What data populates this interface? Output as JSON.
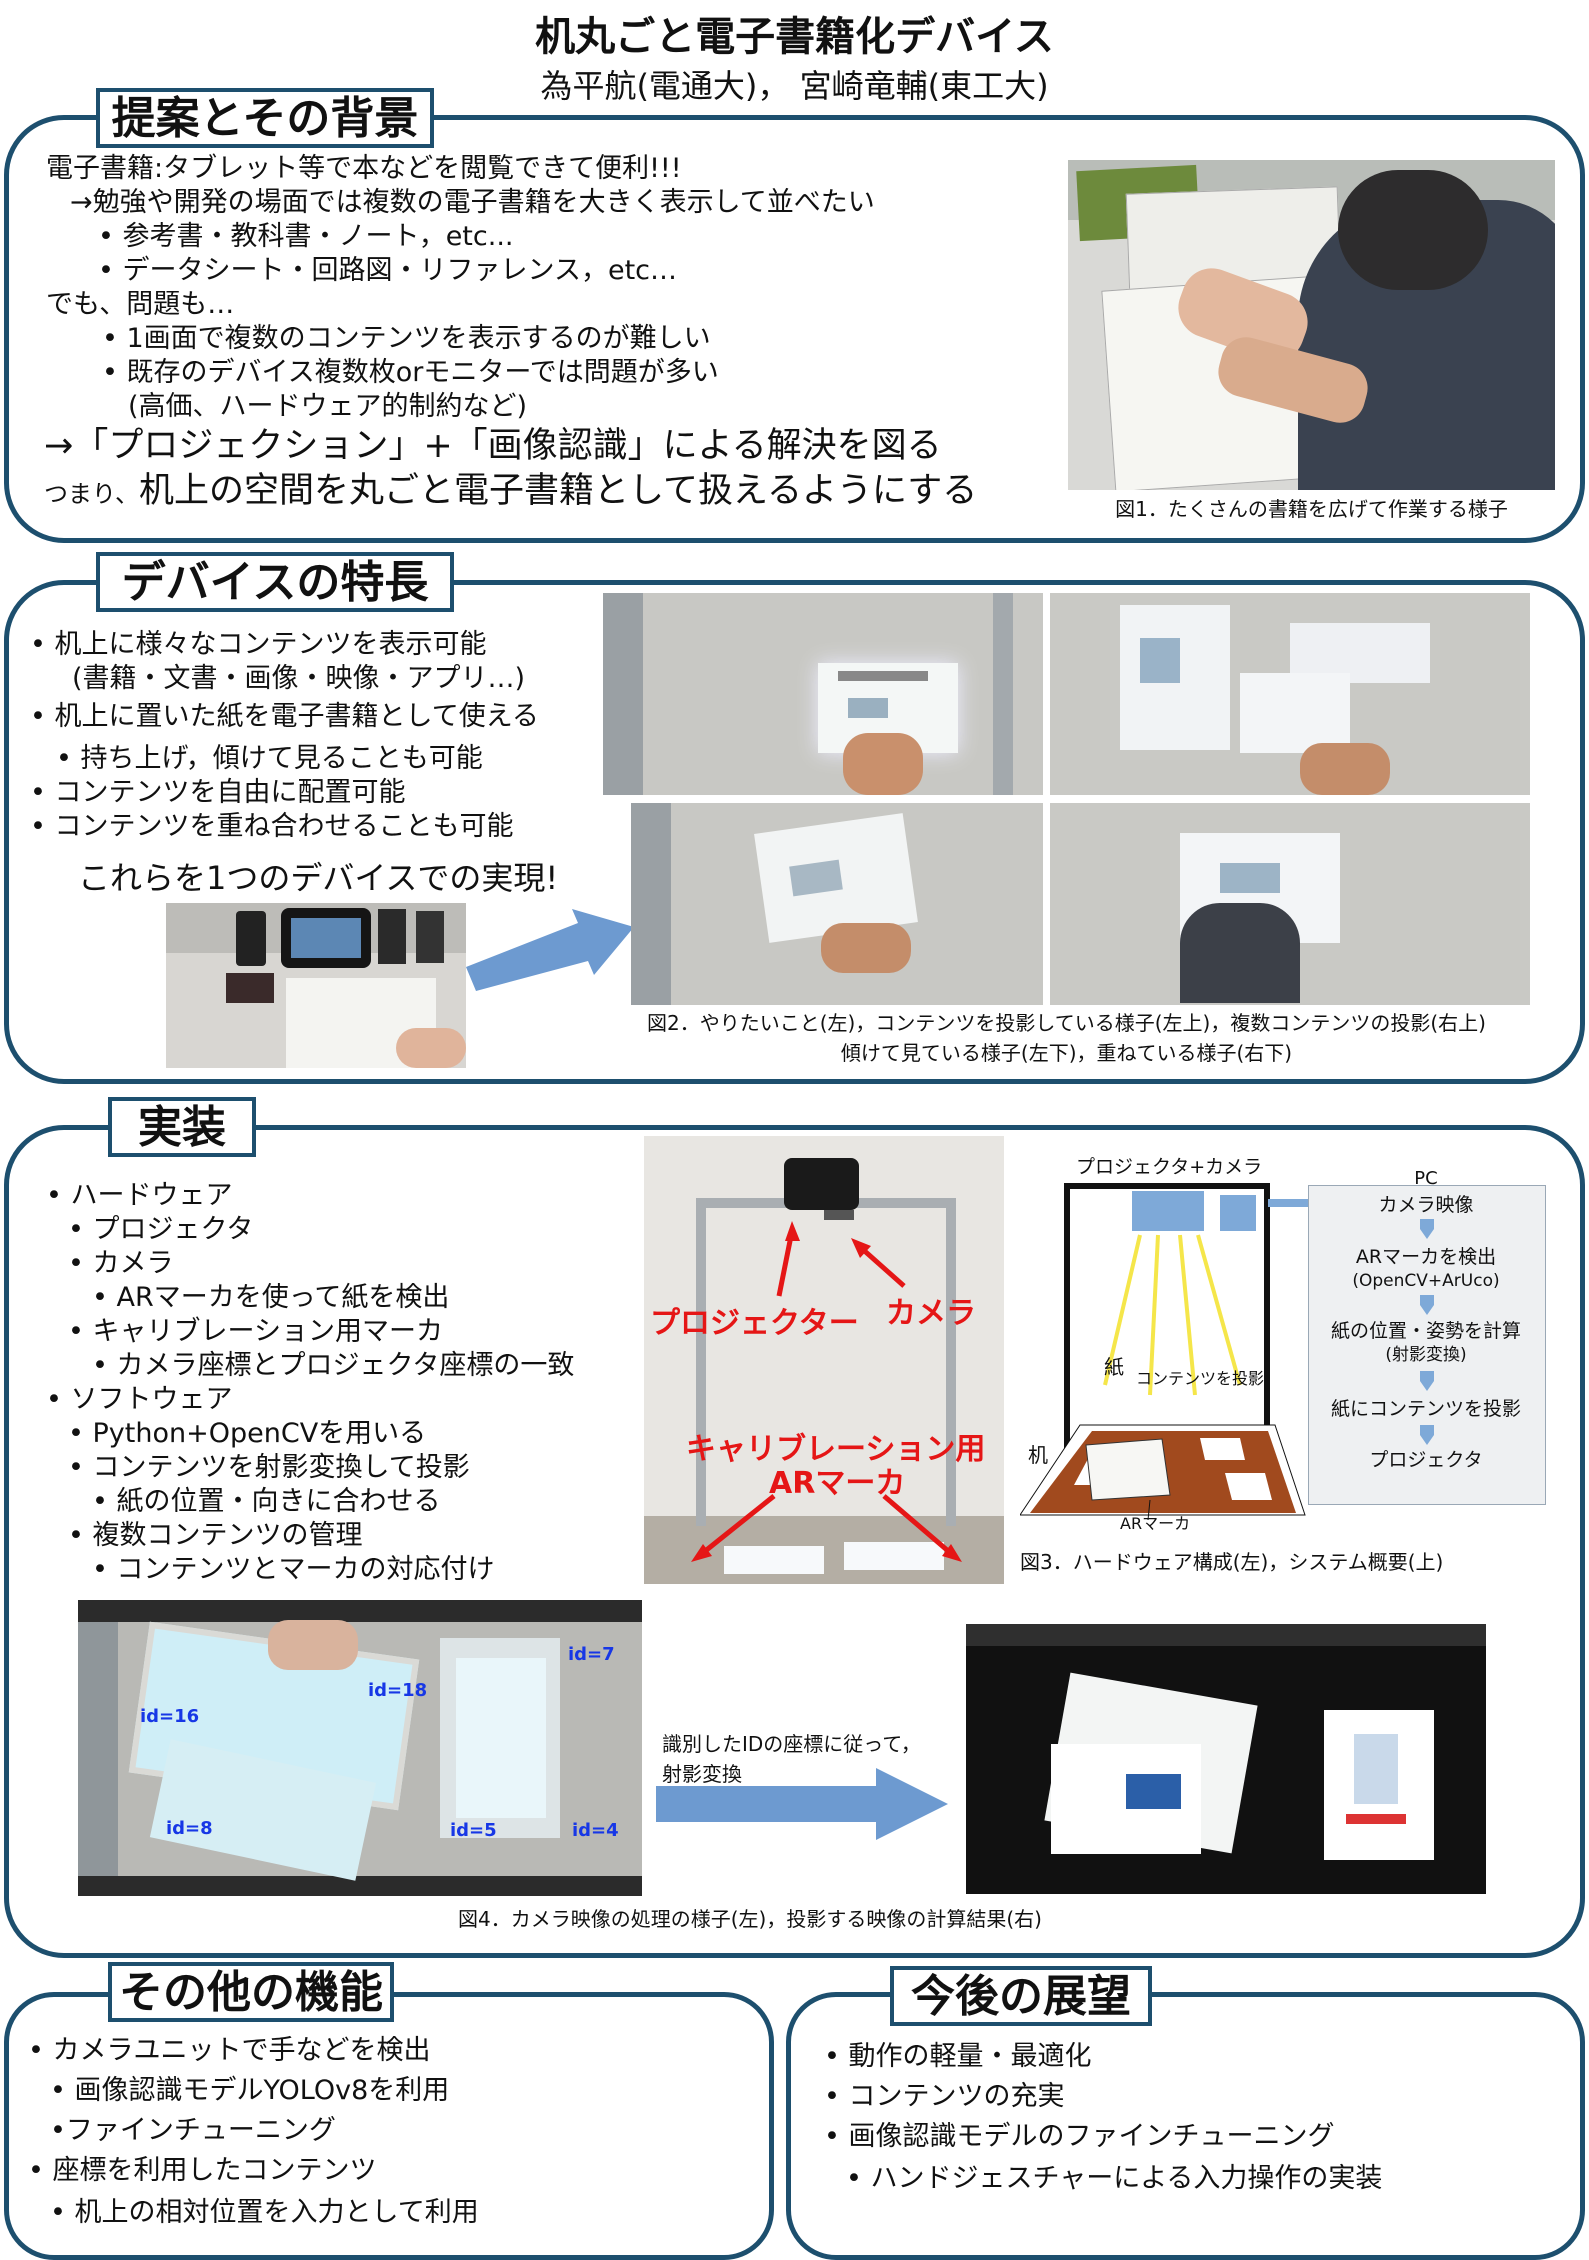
{
  "header": {
    "title": "机丸ごと電子書籍化デバイス",
    "authors": "為平航(電通大)， 宮崎竜輔(東工大)"
  },
  "sec1": {
    "label": "提案とその背景",
    "lines": [
      "電子書籍:タブレット等で本などを閲覧できて便利!!!",
      "→勉強や開発の場面では複数の電子書籍を大きく表示して並べたい",
      "• 参考書・教科書・ノート，etc...",
      "• データシート・回路図・リファレンス，etc…",
      "でも、問題も…",
      "• 1画面で複数のコンテンツを表示するのが難しい",
      "• 既存のデバイス複数枚orモニターでは問題が多い",
      "(高価、ハードウェア的制約など)"
    ],
    "big1": "→「プロジェクション」+「画像認識」による解決を図る",
    "small": "つまり、",
    "big2": "机上の空間を丸ごと電子書籍として扱えるようにする",
    "fig1_caption": "図1．たくさんの書籍を広げて作業する様子"
  },
  "sec2": {
    "label": "デバイスの特長",
    "lines": [
      "• 机上に様々なコンテンツを表示可能",
      "(書籍・文書・画像・映像・アプリ…)",
      "• 机上に置いた紙を電子書籍として使える",
      "• 持ち上げ，傾けて見ることも可能",
      "• コンテンツを自由に配置可能",
      "• コンテンツを重ね合わせることも可能"
    ],
    "summary": "これらを1つのデバイスでの実現!",
    "fig2_caption1": "図2．やりたいこと(左)，コンテンツを投影している様子(左上)，複数コンテンツの投影(右上)",
    "fig2_caption2": "傾けて見ている様子(左下)，重ねている様子(右下)"
  },
  "sec3": {
    "label": "実装",
    "lines": [
      "• ハードウェア",
      "• プロジェクタ",
      "• カメラ",
      "• ARマーカを使って紙を検出",
      "• キャリブレーション用マーカ",
      "• カメラ座標とプロジェクタ座標の一致",
      "• ソフトウェア",
      "• Python+OpenCVを用いる",
      "• コンテンツを射影変換して投影",
      "• 紙の位置・向きに合わせる",
      "• 複数コンテンツの管理",
      "• コンテンツとマーカの対応付け"
    ],
    "photo_labels": {
      "projector": "プロジェクター",
      "camera": "カメラ",
      "calib1": "キャリブレーション用",
      "calib2": "ARマーカ"
    },
    "diagram": {
      "top": "プロジェクタ+カメラ",
      "paper": "紙",
      "content": "コンテンツを投影",
      "desk": "机",
      "marker": "ARマーカ",
      "pc": "PC",
      "steps": [
        "カメラ映像",
        "ARマーカを検出",
        "(OpenCV+ArUco)",
        "紙の位置・姿勢を計算",
        "(射影変換)",
        "紙にコンテンツを投影",
        "プロジェクタ"
      ]
    },
    "fig3_caption": "図3．ハードウェア構成(左)，システム概要(上)",
    "ids": [
      "id=18",
      "id=7",
      "id=16",
      "id=8",
      "id=5",
      "id=4"
    ],
    "arrow_text1": "識別したIDの座標に従って，",
    "arrow_text2": "射影変換",
    "fig4_caption": "図4．カメラ映像の処理の様子(左)，投影する映像の計算結果(右)"
  },
  "sec4": {
    "label": "その他の機能",
    "lines": [
      "• カメラユニットで手などを検出",
      "• 画像認識モデルYOLOv8を利用",
      "•ファインチューニング",
      "• 座標を利用したコンテンツ",
      "• 机上の相対位置を入力として利用"
    ]
  },
  "sec5": {
    "label": "今後の展望",
    "lines": [
      "• 動作の軽量・最適化",
      "• コンテンツの充実",
      "• 画像認識モデルのファインチューニング",
      "• ハンドジェスチャーによる入力操作の実装"
    ]
  }
}
